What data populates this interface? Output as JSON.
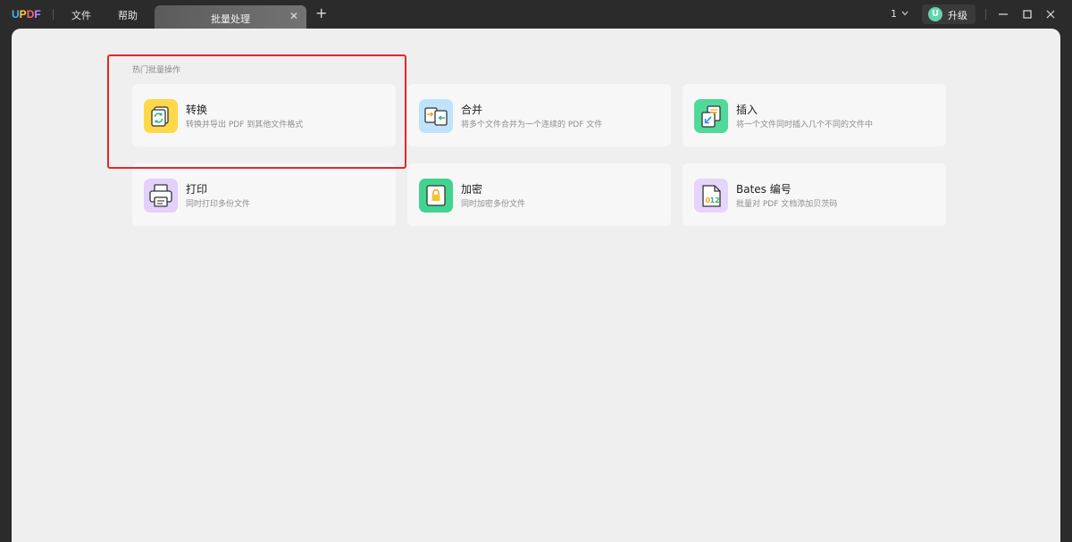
{
  "app": {
    "logo": {
      "u": "U",
      "p": "P",
      "d": "D",
      "f": "F"
    },
    "menu": {
      "file": "文件",
      "help": "帮助"
    },
    "tab": {
      "label": "批量处理",
      "close": "✕"
    },
    "add_tab": "+",
    "page_count": "1",
    "upgrade": {
      "avatar": "U",
      "label": "升级"
    }
  },
  "main": {
    "section_title": "热门批量操作",
    "cards": [
      {
        "title": "转换",
        "desc": "转换并导出 PDF 到其他文件格式",
        "icon": "convert-icon",
        "color": "#ffd84a"
      },
      {
        "title": "合并",
        "desc": "将多个文件合并为一个连续的 PDF 文件",
        "icon": "merge-icon",
        "color": "#bfe3fb"
      },
      {
        "title": "插入",
        "desc": "将一个文件同时插入几个不同的文件中",
        "icon": "insert-icon",
        "color": "#4fd99a"
      },
      {
        "title": "打印",
        "desc": "同时打印多份文件",
        "icon": "print-icon",
        "color": "#e3d1fb"
      },
      {
        "title": "加密",
        "desc": "同时加密多份文件",
        "icon": "lock-icon",
        "color": "#41d48f"
      },
      {
        "title": "Bates 编号",
        "desc": "批量对 PDF 文档添加贝茨码",
        "icon": "bates-number-icon",
        "color": "#e7d4fb"
      }
    ]
  },
  "colors": {
    "highlight": "#e8262a",
    "titlebar": "#2b2b2b",
    "content_bg": "#efefef"
  }
}
